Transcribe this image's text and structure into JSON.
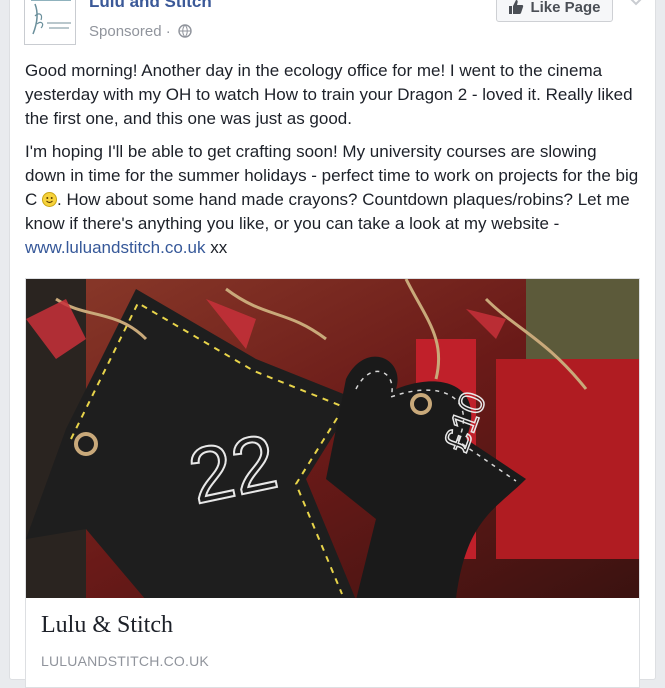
{
  "post": {
    "page_name": "Lulu and Stitch",
    "sponsored": "Sponsored ·",
    "like_button": "Like Page",
    "paragraph1": "Good morning! Another day in the ecology office for me! I went to the cinema yesterday with my OH to watch How to train your Dragon 2 - loved it. Really liked the first one, and this one was just as good.",
    "paragraph2_a": "I'm hoping I'll be able to get crafting soon! My university courses are slowing down in time for the summer holidays - perfect time to work on projects for the big C ",
    "paragraph2_b": ". How about some hand made crayons? Countdown plaques/robins? Let me know if there's anything you like, or you can take a look at my website - ",
    "website_link": "www.luluandstitch.co.uk",
    "paragraph2_end": " xx",
    "photo_price_tag": "£10",
    "photo_number": "22"
  },
  "link_preview": {
    "title": "Lulu & Stitch",
    "domain": "LULUANDSTITCH.CO.UK"
  },
  "icons": {
    "thumbs_up": "thumbs-up-icon",
    "globe": "globe-icon",
    "chevron": "chevron-down-icon",
    "smiley": "smiley-emoji"
  }
}
